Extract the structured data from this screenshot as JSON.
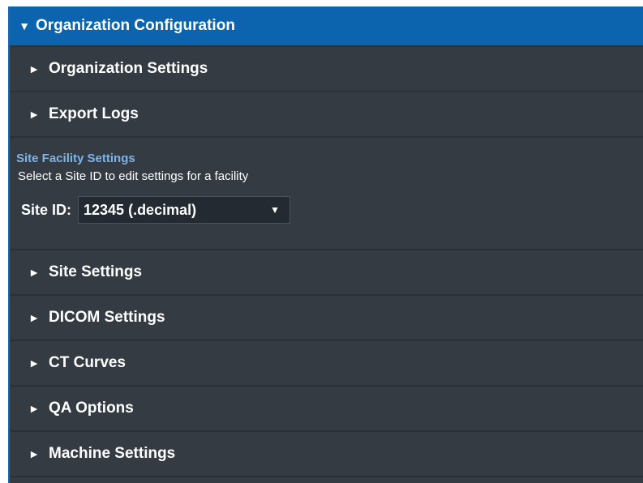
{
  "panel": {
    "title": "Organization Configuration",
    "expanded_icon": "triangle-down-icon"
  },
  "org_rows": [
    {
      "label": "Organization Settings",
      "icon": "triangle-right-icon"
    },
    {
      "label": "Export Logs",
      "icon": "triangle-right-icon"
    }
  ],
  "site_facility": {
    "title": "Site Facility Settings",
    "description": "Select a Site ID to edit settings for a facility",
    "site_id_label": "Site ID:",
    "site_id_value": "12345 (.decimal)",
    "dropdown_icon": "caret-down-icon"
  },
  "site_rows": [
    {
      "label": "Site Settings",
      "icon": "triangle-right-icon"
    },
    {
      "label": "DICOM Settings",
      "icon": "triangle-right-icon"
    },
    {
      "label": "CT Curves",
      "icon": "triangle-right-icon"
    },
    {
      "label": "QA Options",
      "icon": "triangle-right-icon"
    },
    {
      "label": "Machine Settings",
      "icon": "triangle-right-icon"
    }
  ],
  "colors": {
    "header_bg": "#0b64ad",
    "panel_bg": "#343b43",
    "section_title": "#7fb4e6",
    "text": "#ffffff"
  }
}
